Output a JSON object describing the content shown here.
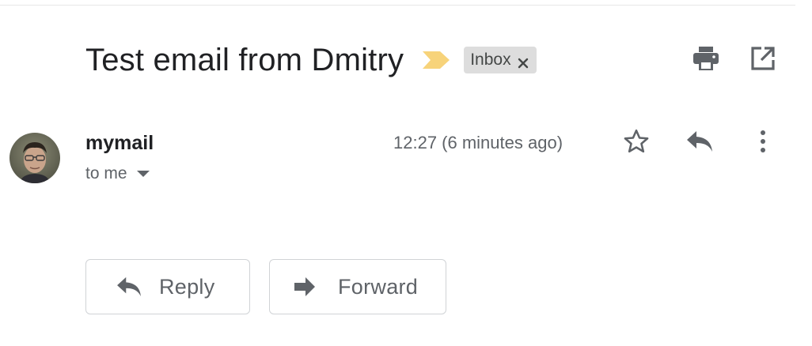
{
  "email": {
    "subject": "Test email from Dmitry",
    "importance_icon": "importance-marker-icon",
    "labels": [
      {
        "name": "Inbox",
        "remove_icon": "close-icon"
      }
    ],
    "header_actions": [
      "print-icon",
      "open-in-new-window-icon"
    ]
  },
  "message": {
    "sender_name": "mymail",
    "recipient_text": "to me",
    "timestamp": "12:27 (6 minutes ago)",
    "actions": [
      "star-icon",
      "reply-icon",
      "more-vert-icon"
    ]
  },
  "footer": {
    "reply_label": "Reply",
    "forward_label": "Forward"
  },
  "colors": {
    "importance_marker": "#f7d37a",
    "chip_background": "#dddddd",
    "icon_gray": "#5f6368",
    "text_primary": "#202124"
  }
}
